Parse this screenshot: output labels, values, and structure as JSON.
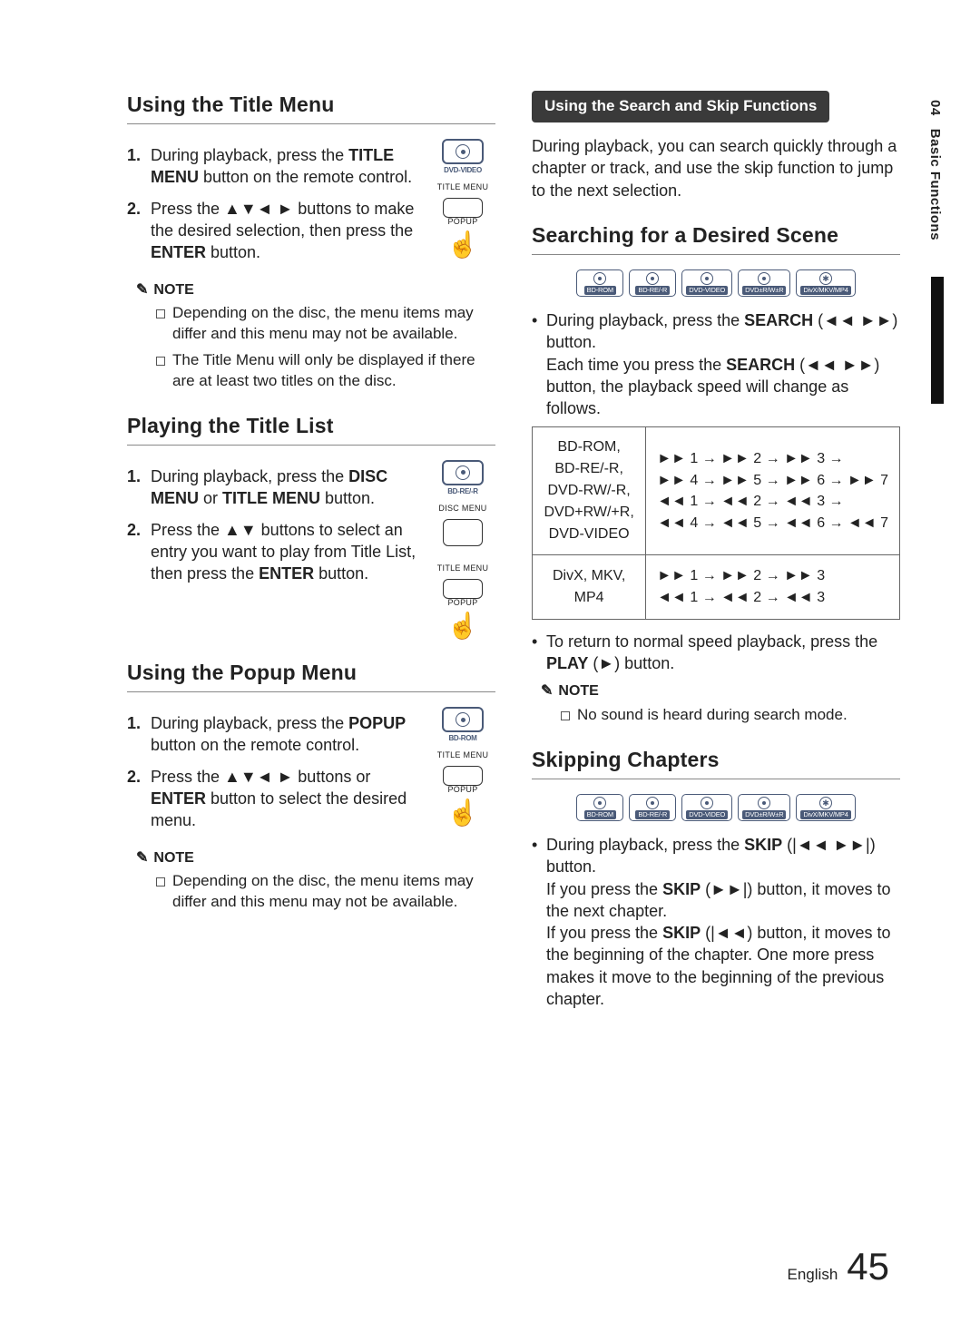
{
  "sidebar": {
    "chapter": "04",
    "title": "Basic Functions"
  },
  "left": {
    "s1": {
      "heading": "Using the Title Menu",
      "disc_label": "DVD-VIDEO",
      "btn_title": "TITLE MENU",
      "btn_popup": "POPUP",
      "step1_a": "During playback, press the ",
      "step1_b": "TITLE MENU",
      "step1_c": " button on the remote control.",
      "step2_a": "Press the ▲▼◄ ► buttons to make the desired selection, then press the ",
      "step2_b": "ENTER",
      "step2_c": " button.",
      "note_label": "NOTE",
      "note1": "Depending on the disc, the menu items may differ and this menu may not be available.",
      "note2": "The Title Menu will only be displayed if there are at least two titles on the disc."
    },
    "s2": {
      "heading": "Playing the Title List",
      "disc_label": "BD-RE/-R",
      "btn_disc": "DISC MENU",
      "btn_title": "TITLE MENU",
      "btn_popup": "POPUP",
      "step1_a": "During playback, press the ",
      "step1_b": "DISC MENU",
      "step1_c": " or ",
      "step1_d": "TITLE MENU",
      "step1_e": " button.",
      "step2_a": "Press the ▲▼ buttons to select an entry you want to play from Title List, then press the ",
      "step2_b": "ENTER",
      "step2_c": " button."
    },
    "s3": {
      "heading": "Using the Popup Menu",
      "disc_label": "BD-ROM",
      "btn_title": "TITLE MENU",
      "btn_popup": "POPUP",
      "step1_a": "During playback, press the ",
      "step1_b": "POPUP",
      "step1_c": " button on the remote control.",
      "step2_a": "Press the ▲▼◄ ► buttons or ",
      "step2_b": "ENTER",
      "step2_c": " button to select the desired menu.",
      "note_label": "NOTE",
      "note1": "Depending on the disc, the menu items may differ and this menu may not be available."
    }
  },
  "right": {
    "bar": "Using the Search and Skip Functions",
    "intro": "During playback, you can search quickly through a chapter or track, and use the skip function to jump to the next selection.",
    "s1": {
      "heading": "Searching for a Desired Scene",
      "discs": [
        "BD-ROM",
        "BD-RE/-R",
        "DVD-VIDEO",
        "DVD±R/W±R",
        "DivX/MKV/MP4"
      ],
      "b1_a": "During playback, press the ",
      "b1_b": "SEARCH",
      "b1_c": " (◄◄ ►►) button.",
      "b1_d": "Each time you press the ",
      "b1_e": "SEARCH",
      "b1_f": " (◄◄ ►►) button, the playback speed will change as follows.",
      "table": {
        "r1_left": "BD-ROM,\nBD-RE/-R,\nDVD-RW/-R,\nDVD+RW/+R,\nDVD-VIDEO",
        "r1_l1": "►► 1 → ►► 2 → ►► 3 →",
        "r1_l2": "►► 4 → ►► 5 → ►► 6 → ►► 7",
        "r1_l3": "◄◄ 1 → ◄◄ 2 → ◄◄ 3 →",
        "r1_l4": "◄◄ 4 → ◄◄ 5 → ◄◄ 6 → ◄◄ 7",
        "r2_left": "DivX, MKV, MP4",
        "r2_l1": "►► 1 → ►► 2 → ►► 3",
        "r2_l2": "◄◄ 1 → ◄◄ 2 → ◄◄ 3"
      },
      "b2_a": "To return to normal speed playback, press the ",
      "b2_b": "PLAY",
      "b2_c": " (►) button.",
      "note_label": "NOTE",
      "note1": "No sound is heard during search mode."
    },
    "s2": {
      "heading": "Skipping Chapters",
      "discs": [
        "BD-ROM",
        "BD-RE/-R",
        "DVD-VIDEO",
        "DVD±R/W±R",
        "DivX/MKV/MP4"
      ],
      "b1_a": "During playback, press the ",
      "b1_b": "SKIP",
      "b1_c": " (|◄◄ ►►|) button.",
      "b1_d": "If you press the ",
      "b1_e": "SKIP",
      "b1_f": " (►►|) button, it moves to the next chapter.",
      "b1_g": "If you press the ",
      "b1_h": "SKIP",
      "b1_i": " (|◄◄) button, it moves to the beginning of the chapter. One more press makes it move to the beginning of the previous chapter."
    }
  },
  "footer": {
    "lang": "English",
    "page": "45"
  }
}
